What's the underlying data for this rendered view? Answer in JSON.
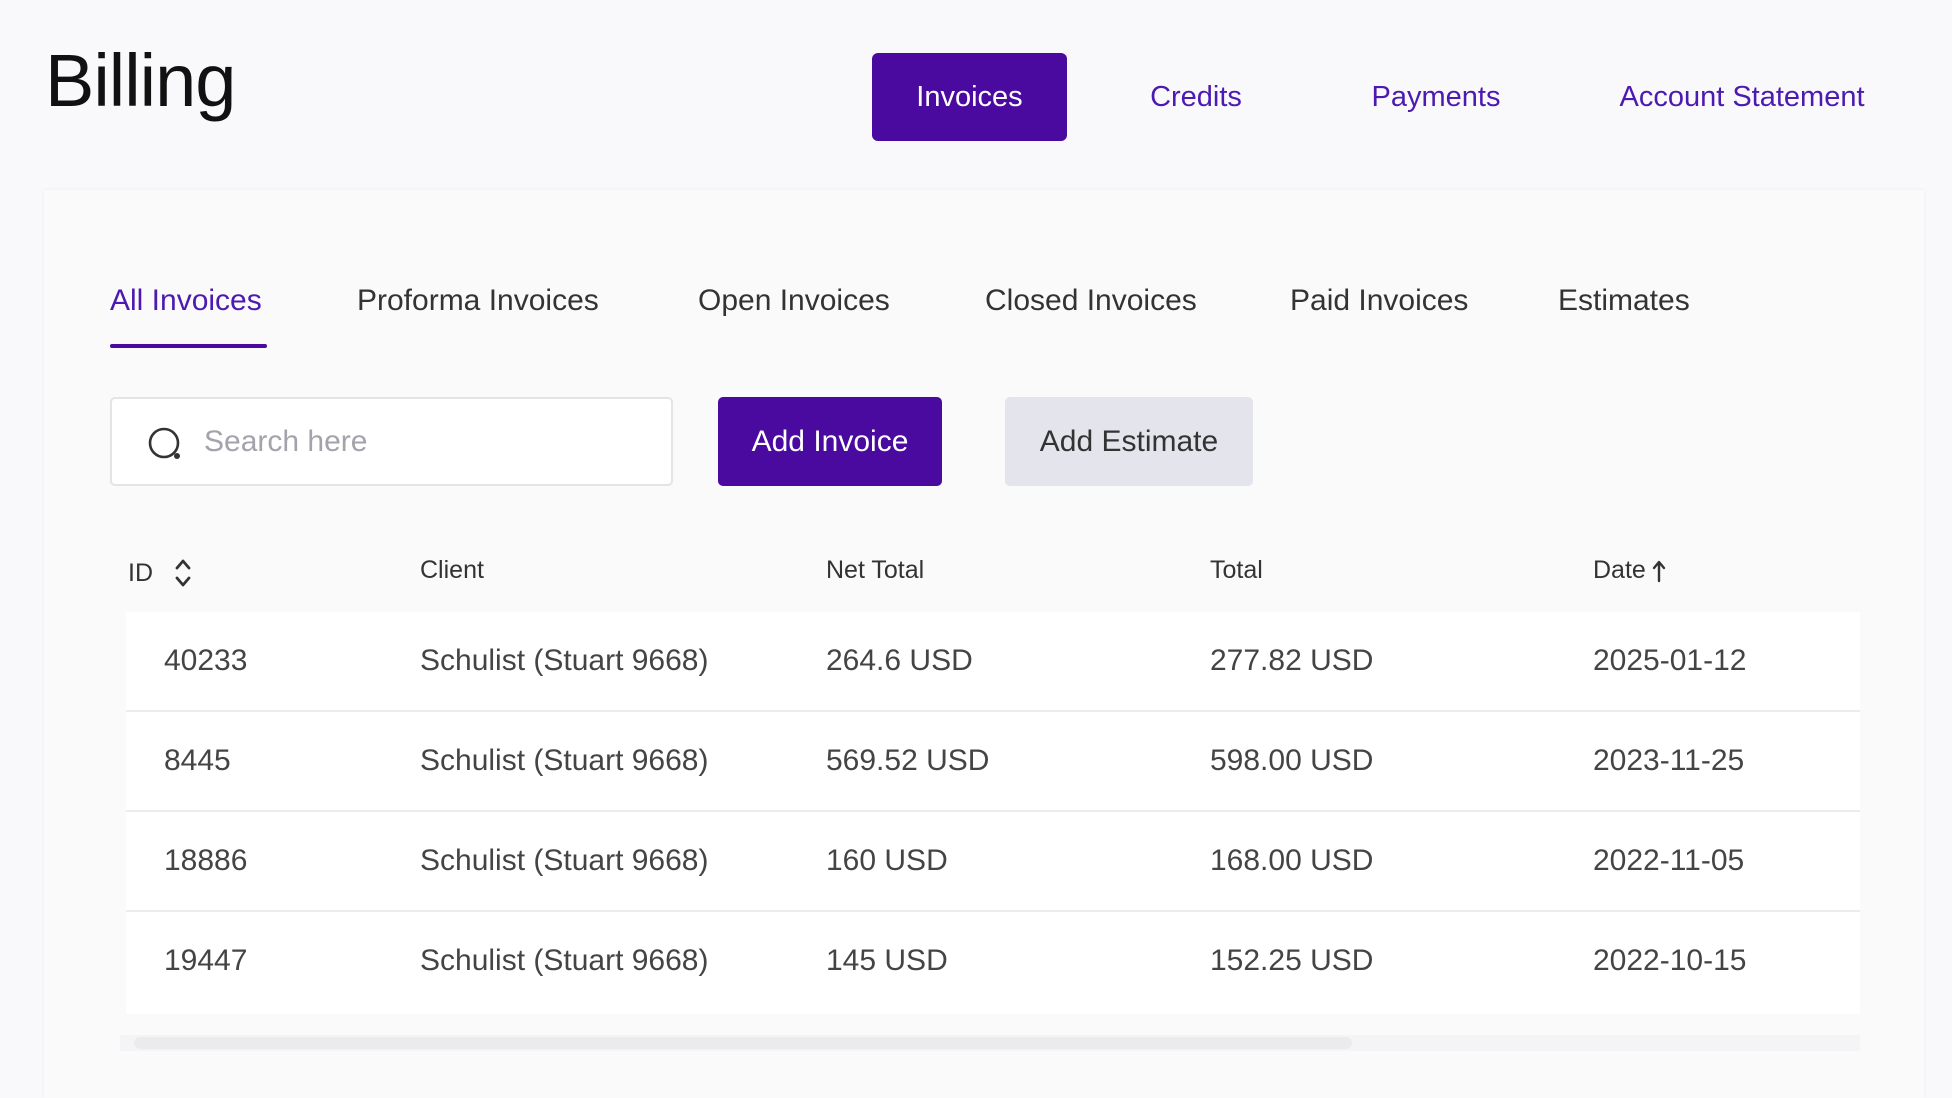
{
  "header": {
    "title": "Billing",
    "tabs": [
      {
        "label": "Invoices",
        "active": true
      },
      {
        "label": "Credits",
        "active": false
      },
      {
        "label": "Payments",
        "active": false
      },
      {
        "label": "Account Statement",
        "active": false
      }
    ]
  },
  "subtabs": [
    {
      "label": "All Invoices",
      "active": true
    },
    {
      "label": "Proforma Invoices",
      "active": false
    },
    {
      "label": "Open Invoices",
      "active": false
    },
    {
      "label": "Closed Invoices",
      "active": false
    },
    {
      "label": "Paid Invoices",
      "active": false
    },
    {
      "label": "Estimates",
      "active": false
    }
  ],
  "search": {
    "placeholder": "Search here",
    "value": "",
    "icon": "search-icon"
  },
  "actions": {
    "add_invoice": "Add Invoice",
    "add_estimate": "Add Estimate"
  },
  "table": {
    "columns": {
      "id": "ID",
      "client": "Client",
      "net_total": "Net Total",
      "total": "Total",
      "date": "Date"
    },
    "rows": [
      {
        "id": "40233",
        "client": "Schulist (Stuart 9668)",
        "net_total": "264.6 USD",
        "total": "277.82 USD",
        "date": "2025-01-12"
      },
      {
        "id": "8445",
        "client": "Schulist (Stuart 9668)",
        "net_total": "569.52 USD",
        "total": "598.00 USD",
        "date": "2023-11-25"
      },
      {
        "id": "18886",
        "client": "Schulist (Stuart 9668)",
        "net_total": "160 USD",
        "total": "168.00 USD",
        "date": "2022-11-05"
      },
      {
        "id": "19447",
        "client": "Schulist (Stuart 9668)",
        "net_total": "145 USD",
        "total": "152.25 USD",
        "date": "2022-10-15"
      }
    ]
  },
  "colors": {
    "accent": "#4a0aa0",
    "accent_text": "#4c1ab0",
    "secondary_button": "#e3e4ec"
  }
}
